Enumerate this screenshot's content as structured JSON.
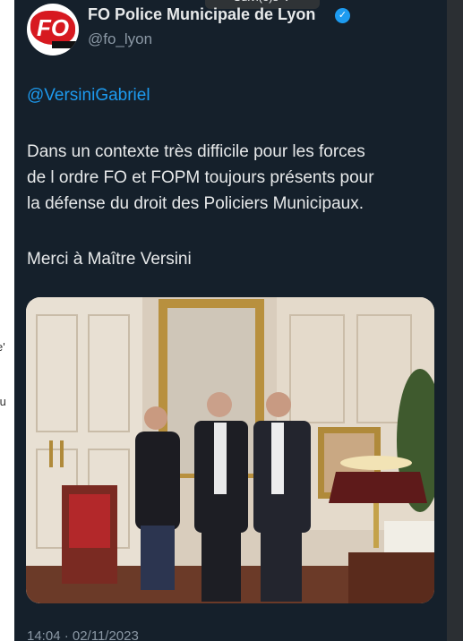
{
  "overlay": {
    "follow_label": "Suivi(e)s  ⌄"
  },
  "tweet": {
    "author_name": "FO Police Municipale de Lyon",
    "handle": "@fo_lyon",
    "mention": "@VersiniGabriel",
    "body_lines": [
      "Dans un contexte très difficile pour les forces",
      "de l ordre FO et FOPM toujours présents pour",
      "la défense du droit des Policiers Municipaux."
    ],
    "closing": "Merci à Maître Versini",
    "timestamp": "14:04 · 02/11/2023"
  },
  "avatar": {
    "text": "FO",
    "brand_color": "#d71920"
  },
  "left_fragments": [
    "e'",
    "tu"
  ],
  "colors": {
    "background": "#15202b",
    "link": "#1d9bf0",
    "verified": "#1d9bf0"
  }
}
